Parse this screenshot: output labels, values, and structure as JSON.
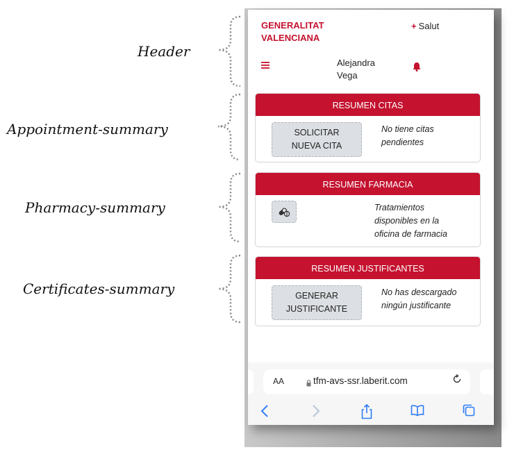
{
  "annotations": {
    "header": "Header",
    "appointment": "Appointment-summary",
    "pharmacy": "Pharmacy-summary",
    "certificates": "Certificates-summary"
  },
  "header": {
    "brand_line1": "GENERALITAT",
    "brand_line2": "VALENCIANA",
    "salut_plus": "+",
    "salut_label": "Salut",
    "menu_icon": "hamburger-menu-icon",
    "user_first": "Alejandra",
    "user_last": "Vega",
    "bell_icon": "bell-icon"
  },
  "appointments": {
    "title": "RESUMEN CITAS",
    "button_line1": "SOLICITAR",
    "button_line2": "NUEVA CITA",
    "note_line1": "No tiene citas",
    "note_line2": "pendientes"
  },
  "pharmacy": {
    "title": "RESUMEN FARMACIA",
    "icon": "pills-icon",
    "note_line1": "Tratamientos",
    "note_line2": "disponibles en la",
    "note_line3": "oficina de farmacia"
  },
  "certificates": {
    "title": "RESUMEN JUSTIFICANTES",
    "button_line1": "GENERAR",
    "button_line2": "JUSTIFICANTE",
    "note_line1": "No has descargado",
    "note_line2": "ningún justificante"
  },
  "browser": {
    "text_size_label": "AA",
    "url": "tfm-avs-ssr.laberit.com",
    "lock_icon": "lock-icon",
    "reload_icon": "reload-icon",
    "toolbar_icons": [
      "back-icon",
      "forward-icon",
      "share-icon",
      "bookmarks-icon",
      "tabs-icon"
    ]
  },
  "colors": {
    "brand_red": "#c4122f",
    "button_grey": "#dcdfe3",
    "ios_blue": "#2f7cf6"
  }
}
